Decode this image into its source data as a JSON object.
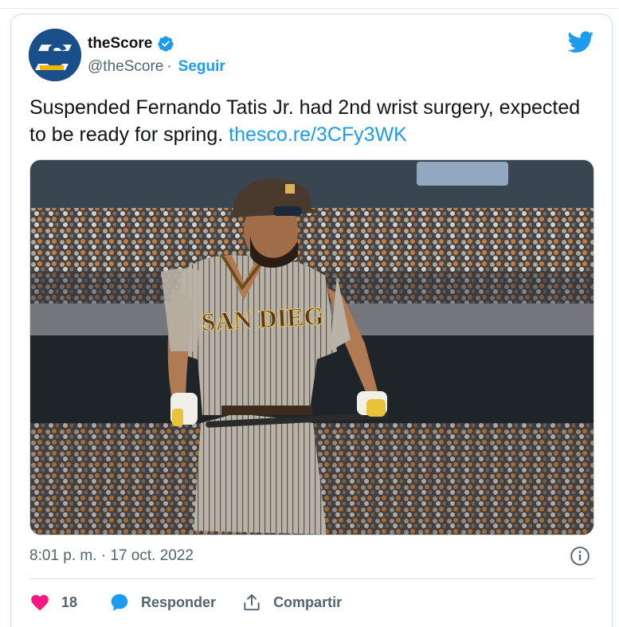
{
  "author": {
    "name": "theScore",
    "handle": "@theScore",
    "separator": "·",
    "follow_label": "Seguir",
    "verified": true,
    "avatar_letter": "S"
  },
  "tweet": {
    "text": "Suspended Fernando Tatis Jr. had 2nd wrist surgery, expected to be ready for spring.",
    "link": "thesco.re/3CFy3WK"
  },
  "media": {
    "jersey_text": "SAN DIEG"
  },
  "meta": {
    "timestamp": "8:01 p. m. · 17 oct. 2022"
  },
  "actions": {
    "likes": "18",
    "reply_label": "Responder",
    "share_label": "Compartir"
  },
  "colors": {
    "accent": "#1d9bf0",
    "like": "#f91880",
    "muted": "#536471",
    "brand_avatar": "#1b4f8c"
  },
  "icons": [
    "twitter-bird-icon",
    "verified-badge-icon",
    "info-icon",
    "heart-icon",
    "reply-bubble-icon",
    "share-icon"
  ]
}
